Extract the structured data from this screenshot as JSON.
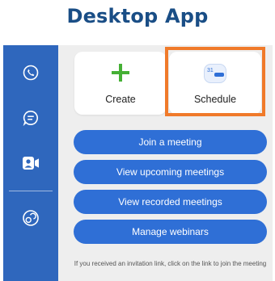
{
  "heading": "Desktop App",
  "sidebar": {
    "items": [
      {
        "icon": "phone-icon"
      },
      {
        "icon": "chat-icon"
      },
      {
        "icon": "meetings-icon"
      },
      {
        "icon": "contacts-icon"
      }
    ]
  },
  "cards": {
    "create_label": "Create",
    "schedule_label": "Schedule",
    "calendar_day": "31"
  },
  "buttons": {
    "join": "Join a meeting",
    "upcoming": "View upcoming meetings",
    "recorded": "View recorded meetings",
    "webinars": "Manage webinars"
  },
  "hint": "If you received an invitation link, click on the link to join the meeting",
  "colors": {
    "heading": "#1a4e86",
    "sidebar": "#2f67bd",
    "button": "#2f6fd6",
    "highlight": "#f07a2a",
    "create_icon": "#45b035",
    "background": "#eeeeee"
  }
}
